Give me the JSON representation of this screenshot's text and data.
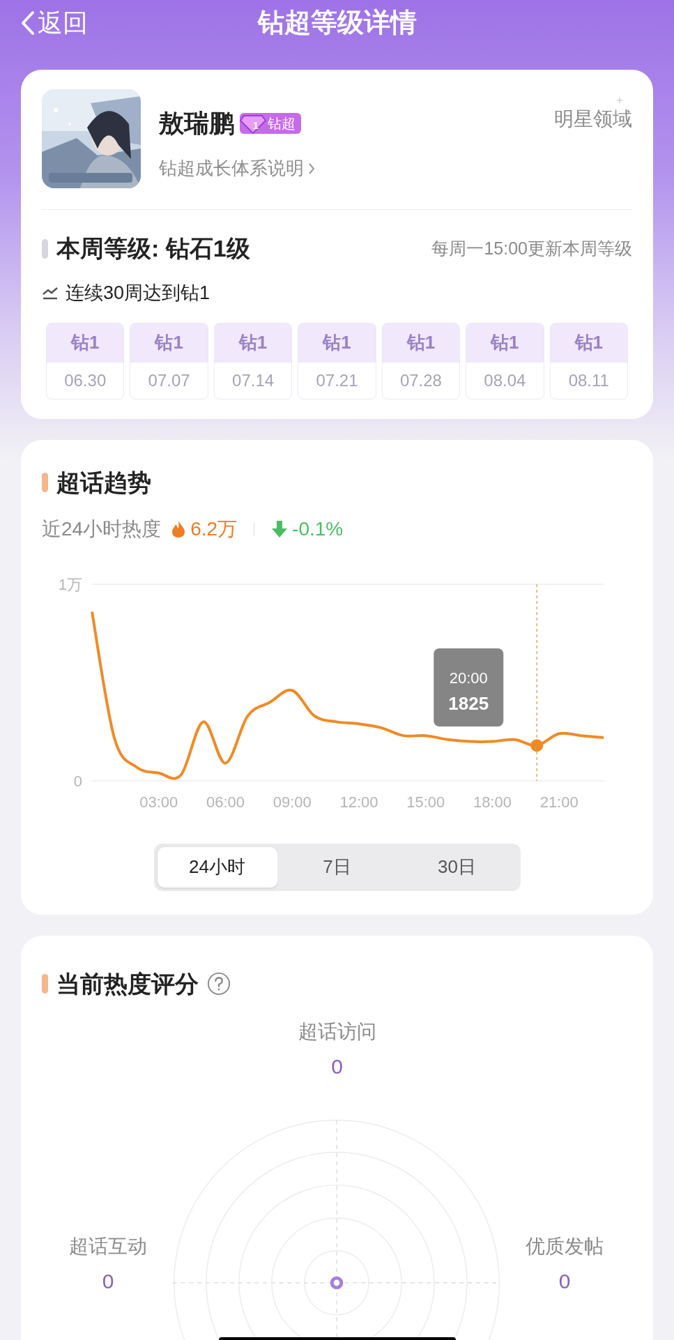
{
  "nav": {
    "back": "返回",
    "title": "钻超等级详情"
  },
  "profile": {
    "name": "敖瑞鹏",
    "badge": {
      "rank_digit": "1",
      "label": "钻超"
    },
    "link": "钻超成长体系说明",
    "tag": "明星领域"
  },
  "weekly": {
    "title": "本周等级: 钻石1级",
    "note": "每周一15:00更新本周等级",
    "streak": "连续30周达到钻1",
    "weeks": [
      {
        "rank": "钻1",
        "date": "06.30"
      },
      {
        "rank": "钻1",
        "date": "07.07"
      },
      {
        "rank": "钻1",
        "date": "07.14"
      },
      {
        "rank": "钻1",
        "date": "07.21"
      },
      {
        "rank": "钻1",
        "date": "07.28"
      },
      {
        "rank": "钻1",
        "date": "08.04"
      },
      {
        "rank": "钻1",
        "date": "08.11"
      }
    ]
  },
  "trend": {
    "title": "超话趋势",
    "heat_label": "近24小时热度",
    "heat_value": "6.2万",
    "change": "-0.1%",
    "chart_data": {
      "type": "line",
      "x": [
        0,
        1,
        2,
        3,
        4,
        5,
        6,
        7,
        8,
        9,
        10,
        11,
        12,
        13,
        14,
        15,
        16,
        17,
        18,
        19,
        20,
        21,
        22,
        23
      ],
      "xlim": [
        0,
        23
      ],
      "ylim": [
        0,
        1
      ],
      "series": [
        {
          "color": "#f08a24",
          "values": [
            0.86,
            0.22,
            0.07,
            0.04,
            0.03,
            0.3,
            0.09,
            0.33,
            0.4,
            0.46,
            0.33,
            0.3,
            0.29,
            0.27,
            0.23,
            0.23,
            0.21,
            0.2,
            0.2,
            0.21,
            0.18,
            0.24,
            0.23,
            0.22
          ]
        }
      ],
      "xticks": [
        {
          "value": 3,
          "label": "03:00"
        },
        {
          "value": 6,
          "label": "06:00"
        },
        {
          "value": 9,
          "label": "09:00"
        },
        {
          "value": 12,
          "label": "12:00"
        },
        {
          "value": 15,
          "label": "15:00"
        },
        {
          "value": 18,
          "label": "18:00"
        },
        {
          "value": 21,
          "label": "21:00"
        }
      ],
      "yticks": [
        {
          "value": 0,
          "label": "0"
        },
        {
          "value": 1,
          "label": "1万"
        }
      ],
      "ref_lines": [
        {
          "axis": "x",
          "value": 20
        }
      ],
      "annotations": [
        "20:00",
        "1825"
      ]
    },
    "ranges": [
      {
        "label": "24小时",
        "selected": true
      },
      {
        "label": "7日",
        "selected": false
      },
      {
        "label": "30日",
        "selected": false
      }
    ]
  },
  "score": {
    "title": "当前热度评分",
    "axes": [
      {
        "label": "超话访问",
        "value": "0"
      },
      {
        "label": "超话互动",
        "value": "0"
      },
      {
        "label": "优质发帖",
        "value": "0"
      }
    ]
  }
}
